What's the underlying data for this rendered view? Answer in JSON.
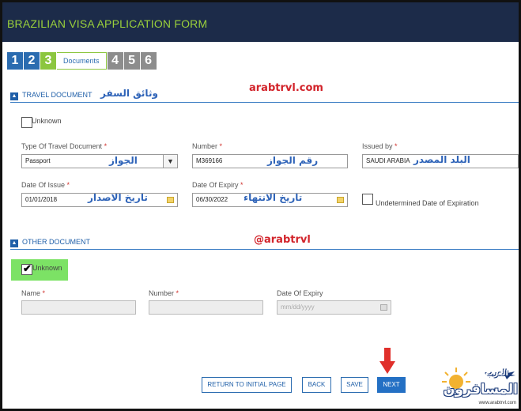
{
  "header": {
    "title": "BRAZILIAN VISA APPLICATION FORM"
  },
  "steps": [
    {
      "num": "1",
      "state": "done"
    },
    {
      "num": "2",
      "state": "done"
    },
    {
      "num": "3",
      "state": "active",
      "label": "Documents"
    },
    {
      "num": "4",
      "state": "todo"
    },
    {
      "num": "5",
      "state": "todo"
    },
    {
      "num": "6",
      "state": "todo"
    }
  ],
  "watermarks": {
    "site": "arabtrvl.com",
    "handle": "@arabtrvl"
  },
  "travel_document": {
    "section_title": "TRAVEL DOCUMENT",
    "section_title_ar": "وثائق السفر",
    "unknown_label": "Unknown",
    "type": {
      "label": "Type Of Travel Document",
      "value": "Passport",
      "annotation_ar": "الجواز"
    },
    "number": {
      "label": "Number",
      "value": "M369166",
      "annotation_ar": "رقم الجواز"
    },
    "issued_by": {
      "label": "Issued by",
      "value": "SAUDI ARABIA",
      "annotation_ar": "البلد المصدر"
    },
    "date_of_issue": {
      "label": "Date Of Issue",
      "value": "01/01/2018",
      "annotation_ar": "تاريخ الاصدار"
    },
    "date_of_expiry": {
      "label": "Date Of Expiry",
      "value": "06/30/2022",
      "annotation_ar": "تاريخ الانتهاء"
    },
    "undetermined_label": "Undetermined Date of Expiration",
    "required_mark": "*"
  },
  "other_document": {
    "section_title": "OTHER DOCUMENT",
    "unknown_label": "Unknown",
    "unknown_checked": true,
    "name": {
      "label": "Name",
      "value": ""
    },
    "number": {
      "label": "Number",
      "value": ""
    },
    "date_of_expiry": {
      "label": "Date Of Expiry",
      "placeholder": "mm/dd/yyyy"
    }
  },
  "buttons": {
    "return": "RETURN TO INITIAL PAGE",
    "back": "BACK",
    "save": "SAVE",
    "next": "NEXT"
  },
  "logo": {
    "text_ar": "المسافرون",
    "small_ar": "العرب",
    "url": "www.arabtrvl.com"
  },
  "colors": {
    "header_bg": "#1c2b49",
    "title": "#9bd13b",
    "accent": "#2470c4",
    "step_active": "#8cc63f",
    "highlight": "#7ce265",
    "annotation": "#2e63b8",
    "watermark": "#d2232a"
  }
}
